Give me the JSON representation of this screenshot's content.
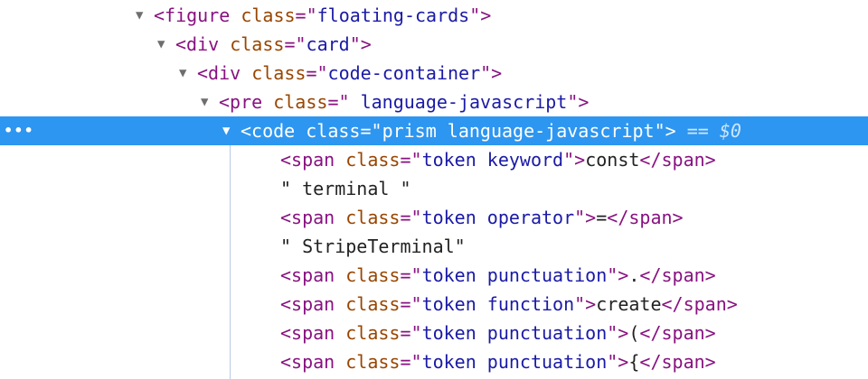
{
  "rows": [
    {
      "depth": 0,
      "arrow": "▼",
      "segs": [
        [
          "tag",
          "<figure "
        ],
        [
          "attr",
          "class"
        ],
        [
          "tag",
          "=\""
        ],
        [
          "val",
          "floating-cards"
        ],
        [
          "tag",
          "\">"
        ]
      ]
    },
    {
      "depth": 1,
      "arrow": "▼",
      "segs": [
        [
          "tag",
          "<div "
        ],
        [
          "attr",
          "class"
        ],
        [
          "tag",
          "=\""
        ],
        [
          "val",
          "card"
        ],
        [
          "tag",
          "\">"
        ]
      ]
    },
    {
      "depth": 2,
      "arrow": "▼",
      "segs": [
        [
          "tag",
          "<div "
        ],
        [
          "attr",
          "class"
        ],
        [
          "tag",
          "=\""
        ],
        [
          "val",
          "code-container"
        ],
        [
          "tag",
          "\">"
        ]
      ]
    },
    {
      "depth": 3,
      "arrow": "▼",
      "segs": [
        [
          "tag",
          "<pre "
        ],
        [
          "attr",
          "class"
        ],
        [
          "tag",
          "=\""
        ],
        [
          "val",
          "  language-javascript"
        ],
        [
          "tag",
          "\">"
        ]
      ]
    },
    {
      "depth": 4,
      "arrow": "▼",
      "selected": true,
      "segs": [
        [
          "tag",
          "<code "
        ],
        [
          "attr",
          "class"
        ],
        [
          "tag",
          "=\""
        ],
        [
          "val",
          "prism  language-javascript"
        ],
        [
          "tag",
          "\">"
        ],
        [
          "ref",
          " == $0"
        ]
      ]
    },
    {
      "depth": 5,
      "arrow": "",
      "segs": [
        [
          "tag",
          "<span "
        ],
        [
          "attr",
          "class"
        ],
        [
          "tag",
          "=\""
        ],
        [
          "val",
          "token keyword"
        ],
        [
          "tag",
          "\">"
        ],
        [
          "txt",
          "const"
        ],
        [
          "tag",
          "</span>"
        ]
      ]
    },
    {
      "depth": 5,
      "arrow": "",
      "segs": [
        [
          "txt",
          "\" terminal \""
        ]
      ]
    },
    {
      "depth": 5,
      "arrow": "",
      "segs": [
        [
          "tag",
          "<span "
        ],
        [
          "attr",
          "class"
        ],
        [
          "tag",
          "=\""
        ],
        [
          "val",
          "token operator"
        ],
        [
          "tag",
          "\">"
        ],
        [
          "txt",
          "="
        ],
        [
          "tag",
          "</span>"
        ]
      ]
    },
    {
      "depth": 5,
      "arrow": "",
      "segs": [
        [
          "txt",
          "\" StripeTerminal\""
        ]
      ]
    },
    {
      "depth": 5,
      "arrow": "",
      "segs": [
        [
          "tag",
          "<span "
        ],
        [
          "attr",
          "class"
        ],
        [
          "tag",
          "=\""
        ],
        [
          "val",
          "token punctuation"
        ],
        [
          "tag",
          "\">"
        ],
        [
          "txt",
          "."
        ],
        [
          "tag",
          "</span>"
        ]
      ]
    },
    {
      "depth": 5,
      "arrow": "",
      "segs": [
        [
          "tag",
          "<span "
        ],
        [
          "attr",
          "class"
        ],
        [
          "tag",
          "=\""
        ],
        [
          "val",
          "token function"
        ],
        [
          "tag",
          "\">"
        ],
        [
          "txt",
          "create"
        ],
        [
          "tag",
          "</span>"
        ]
      ]
    },
    {
      "depth": 5,
      "arrow": "",
      "segs": [
        [
          "tag",
          "<span "
        ],
        [
          "attr",
          "class"
        ],
        [
          "tag",
          "=\""
        ],
        [
          "val",
          "token punctuation"
        ],
        [
          "tag",
          "\">"
        ],
        [
          "txt",
          "("
        ],
        [
          "tag",
          "</span>"
        ]
      ]
    },
    {
      "depth": 5,
      "arrow": "",
      "segs": [
        [
          "tag",
          "<span "
        ],
        [
          "attr",
          "class"
        ],
        [
          "tag",
          "=\""
        ],
        [
          "val",
          "token punctuation"
        ],
        [
          "tag",
          "\">"
        ],
        [
          "txt",
          "{"
        ],
        [
          "tag",
          "</span>"
        ]
      ]
    }
  ],
  "selected_row_menu": "•••",
  "colors": {
    "selection": "#2d96f0",
    "tag": "#881280",
    "attribute": "#994500",
    "value": "#1a1aa6",
    "text": "#222222"
  }
}
